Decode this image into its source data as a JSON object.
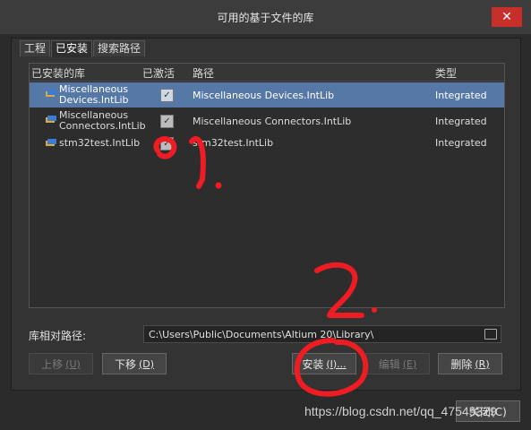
{
  "window": {
    "title": "可用的基于文件的库",
    "close_glyph": "✕"
  },
  "tabs": [
    {
      "label": "工程",
      "active": false
    },
    {
      "label": "已安装",
      "active": true
    },
    {
      "label": "搜索路径",
      "active": false
    }
  ],
  "table": {
    "headers": [
      "已安装的库",
      "已激活",
      "路径",
      "类型"
    ],
    "rows": [
      {
        "name_line1": "Miscellaneous",
        "name_line2": "Devices.IntLib",
        "active": true,
        "path": "Miscellaneous Devices.IntLib",
        "type": "Integrated",
        "selected": true
      },
      {
        "name_line1": "Miscellaneous",
        "name_line2": "Connectors.IntLib",
        "active": true,
        "path": "Miscellaneous Connectors.IntLib",
        "type": "Integrated",
        "selected": false
      },
      {
        "name_line1": "stm32test.IntLib",
        "name_line2": "",
        "active": true,
        "path": "stm32test.IntLib",
        "type": "Integrated",
        "selected": false
      }
    ]
  },
  "relative_path": {
    "label": "库相对路径:",
    "value": "C:\\Users\\Public\\Documents\\Altium     20\\Library\\"
  },
  "buttons": {
    "move_up": {
      "label": "上移",
      "hotkey": "(U)"
    },
    "move_down": {
      "label": "下移",
      "hotkey": "(D)"
    },
    "install": {
      "label": "安装",
      "hotkey": "(I)..."
    },
    "edit": {
      "label": "编辑",
      "hotkey": "(E)"
    },
    "remove": {
      "label": "删除",
      "hotkey": "(R)"
    },
    "close": {
      "label": "关闭(C)"
    }
  },
  "annotations": {
    "mark1": "1.",
    "mark2": "2."
  },
  "watermark": "https://blog.csdn.net/qq_47545329",
  "colors": {
    "selection": "#5578a6",
    "annotation_red": "#ee1c23",
    "close_red": "#c7302a"
  }
}
